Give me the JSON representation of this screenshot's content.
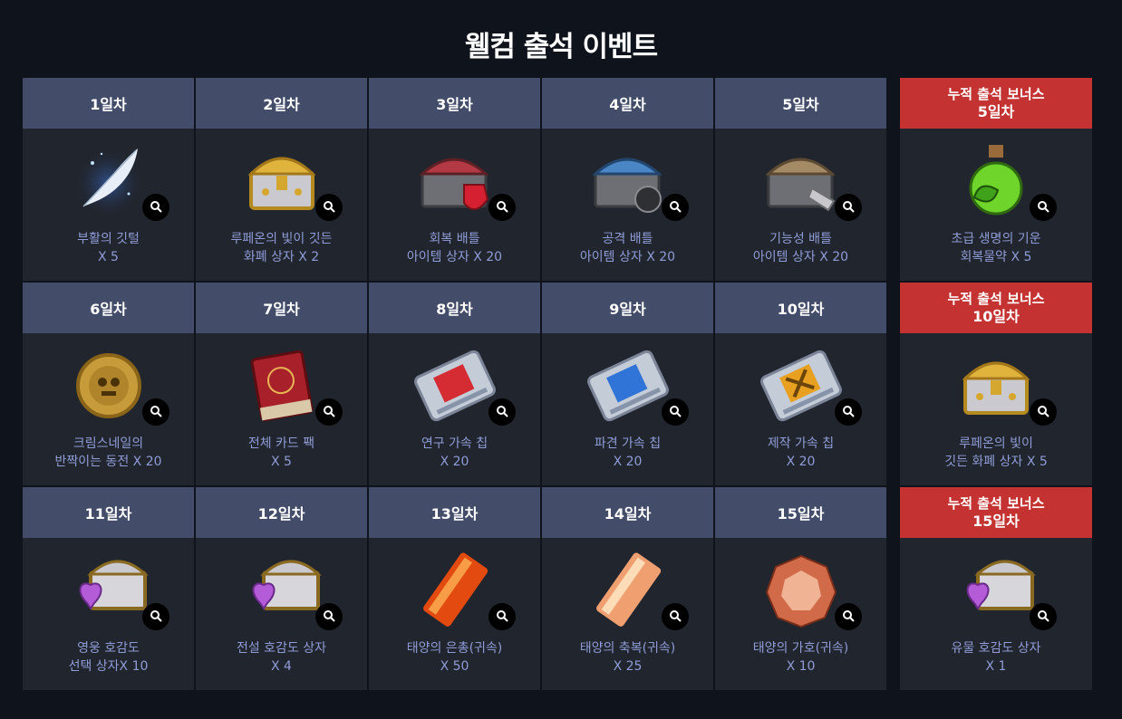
{
  "title": "웰컴 출석 이벤트",
  "days": [
    {
      "label": "1일차",
      "line1": "부활의 깃털",
      "line2": "X 5",
      "icon": "feather-icon"
    },
    {
      "label": "2일차",
      "line1": "루페온의 빛이 깃든",
      "line2": "화폐 상자 X 2",
      "icon": "gold-chest-icon"
    },
    {
      "label": "3일차",
      "line1": "회복 배틀",
      "line2": "아이템 상자 X 20",
      "icon": "red-chest-icon"
    },
    {
      "label": "4일차",
      "line1": "공격 배틀",
      "line2": "아이템 상자 X 20",
      "icon": "blue-chest-icon"
    },
    {
      "label": "5일차",
      "line1": "기능성 배틀",
      "line2": "아이템 상자 X 20",
      "icon": "brown-chest-icon"
    },
    {
      "label": "6일차",
      "line1": "크림스네일의",
      "line2": "반짝이는 동전 X 20",
      "icon": "coin-icon"
    },
    {
      "label": "7일차",
      "line1": "전체 카드 팩",
      "line2": "X 5",
      "icon": "card-pack-icon"
    },
    {
      "label": "8일차",
      "line1": "연구 가속 칩",
      "line2": "X 20",
      "icon": "research-chip-icon"
    },
    {
      "label": "9일차",
      "line1": "파견 가속 칩",
      "line2": "X 20",
      "icon": "dispatch-chip-icon"
    },
    {
      "label": "10일차",
      "line1": "제작 가속 칩",
      "line2": "X 20",
      "icon": "craft-chip-icon"
    },
    {
      "label": "11일차",
      "line1": "영웅 호감도",
      "line2": "선택 상자X 10",
      "icon": "heart-chest-icon"
    },
    {
      "label": "12일차",
      "line1": "전설 호감도 상자",
      "line2": "X 4",
      "icon": "heart-chest-icon"
    },
    {
      "label": "13일차",
      "line1": "태양의 은총(귀속)",
      "line2": "X 50",
      "icon": "red-crystal-icon"
    },
    {
      "label": "14일차",
      "line1": "태양의 축복(귀속)",
      "line2": "X 25",
      "icon": "orange-crystal-icon"
    },
    {
      "label": "15일차",
      "line1": "태양의 가호(귀속)",
      "line2": "X 10",
      "icon": "gem-icon"
    }
  ],
  "bonuses": [
    {
      "label1": "누적 출석 보너스",
      "label2": "5일차",
      "line1": "초급 생명의 기운",
      "line2": "회복물약 X 5",
      "icon": "potion-icon"
    },
    {
      "label1": "누적 출석 보너스",
      "label2": "10일차",
      "line1": "루페온의 빛이",
      "line2": "깃든 화폐 상자 X 5",
      "icon": "gold-chest-icon"
    },
    {
      "label1": "누적 출석 보너스",
      "label2": "15일차",
      "line1": "유물 호감도 상자",
      "line2": "X 1",
      "icon": "heart-chest-icon"
    }
  ],
  "colors": {
    "background": "#0f131b",
    "day_header": "#434d6a",
    "bonus_header": "#c43232",
    "cell": "#21252d",
    "item_text": "#8f9cd7"
  }
}
